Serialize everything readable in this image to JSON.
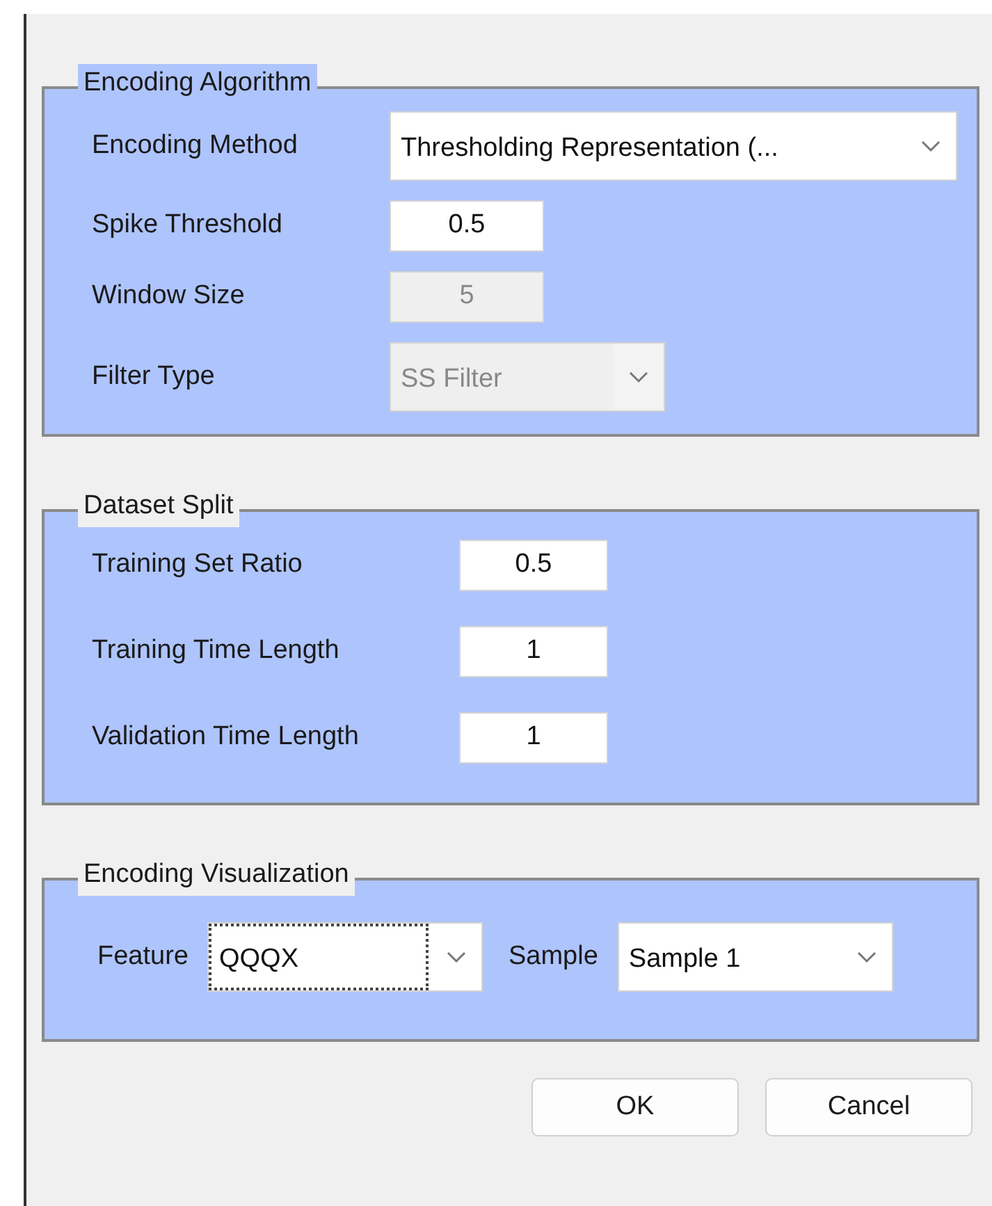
{
  "panels": [
    {
      "title": "Encoding Algorithm",
      "highlighted": true,
      "kind": "rows",
      "rows": [
        {
          "label": "Encoding Method",
          "kind": "dropdown",
          "value": "Thresholding Representation (...",
          "disabled": false,
          "focused": false
        },
        {
          "label": "Spike Threshold",
          "kind": "field",
          "value": "0.5",
          "disabled": false,
          "focused": false
        },
        {
          "label": "Window Size",
          "kind": "field",
          "value": "5",
          "disabled": true,
          "focused": false
        },
        {
          "label": "Filter Type",
          "kind": "dropdown",
          "value": "SS Filter",
          "disabled": true,
          "focused": false
        }
      ]
    },
    {
      "title": "Dataset Split",
      "highlighted": false,
      "kind": "rows",
      "rows": [
        {
          "label": "Training Set Ratio",
          "kind": "field",
          "value": "0.5",
          "disabled": false,
          "focused": false
        },
        {
          "label": "Training Time Length",
          "kind": "field",
          "value": "1",
          "disabled": false,
          "focused": false
        },
        {
          "label": "Validation Time Length",
          "kind": "field",
          "value": "1",
          "disabled": false,
          "focused": false
        }
      ]
    },
    {
      "title": "Encoding Visualization",
      "highlighted": false,
      "kind": "inline",
      "rows": [
        {
          "label": "Feature",
          "kind": "dropdown",
          "value": "QQQX",
          "disabled": false,
          "focused": true
        },
        {
          "label": "Sample",
          "kind": "dropdown",
          "value": "Sample 1",
          "disabled": false,
          "focused": false
        }
      ]
    }
  ],
  "buttons": [
    "OK",
    "Cancel"
  ]
}
